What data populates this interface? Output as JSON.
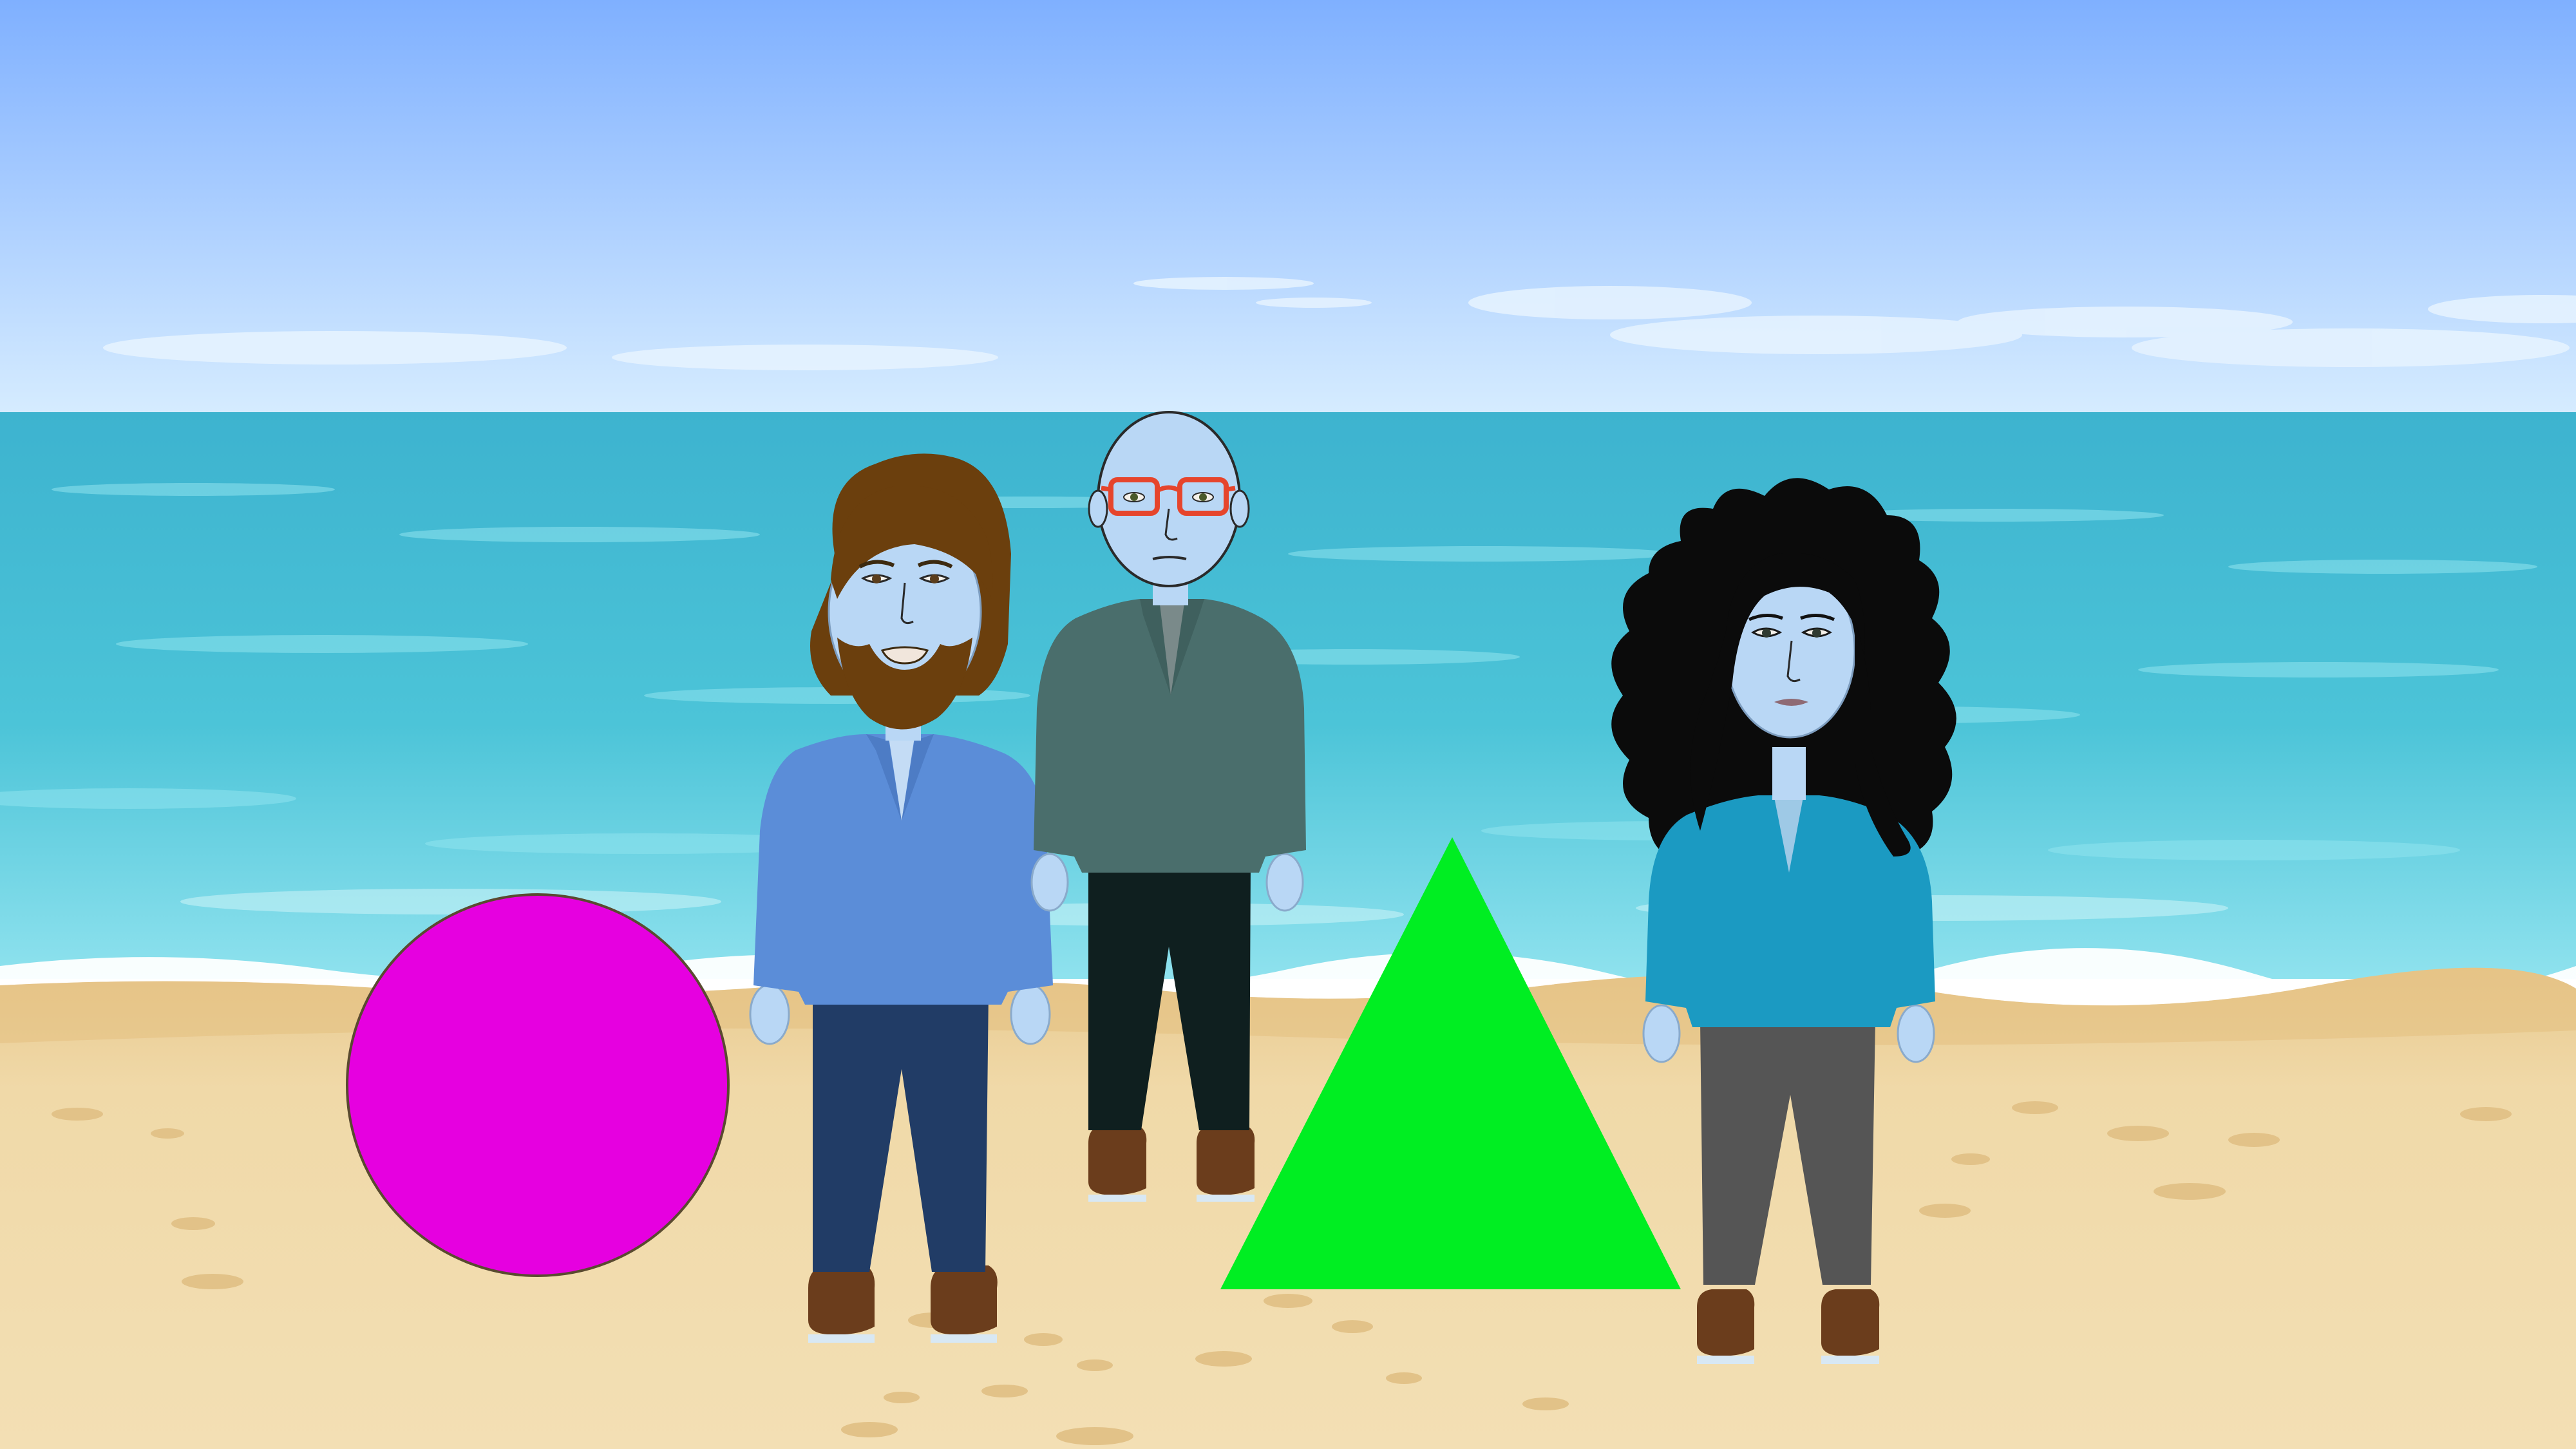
{
  "scene": {
    "setting": "beach",
    "colors": {
      "sky_top": "#7fb0ff",
      "sky_bottom": "#d6ecff",
      "sea_far": "#3db3cf",
      "sea_near": "#7ddcea",
      "foam": "#ffffff",
      "sand": "#f0d9a8",
      "sand_wet": "#e2bf80"
    }
  },
  "shapes": [
    {
      "kind": "circle",
      "color": "#e600e0"
    },
    {
      "kind": "triangle",
      "color": "#00ee22"
    }
  ],
  "characters": [
    {
      "id": "bearded-man",
      "hair": "long-brown",
      "beard": true,
      "hair_color": "#6b3f0d",
      "top_color": "#5b8dd8",
      "pants_color": "#213c66",
      "skin_color": "#b9d7f5",
      "shoe_color": "#6b3d1c"
    },
    {
      "id": "bald-man-glasses",
      "hair": "bald",
      "glasses_color": "#e6452c",
      "top_color": "#4a6e6c",
      "pants_color": "#0f1f1f",
      "skin_color": "#b9d7f5",
      "shoe_color": "#6b3d1c"
    },
    {
      "id": "curly-haired-woman",
      "hair": "long-curly-black",
      "hair_color": "#0b0b0b",
      "top_color": "#1b9ac2",
      "pants_color": "#555555",
      "skin_color": "#b9d7f5",
      "shoe_color": "#6b3d1c"
    }
  ]
}
